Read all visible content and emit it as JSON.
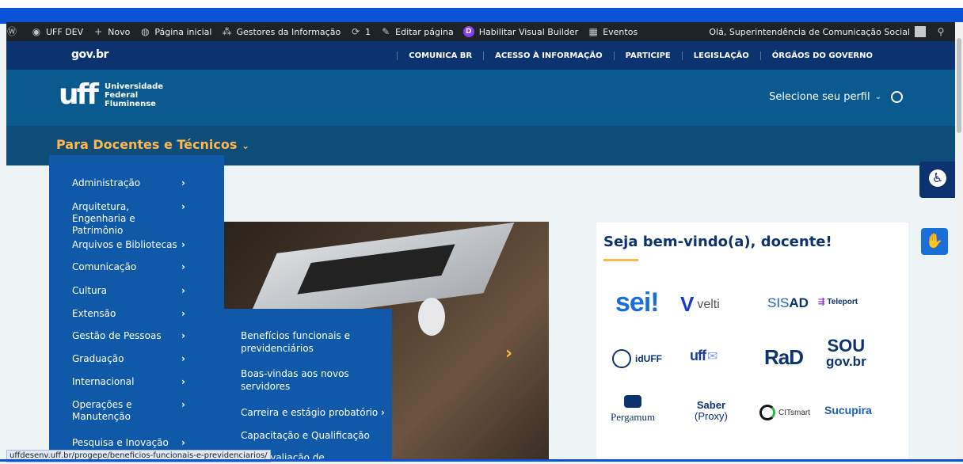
{
  "wpbar": {
    "site": "UFF DEV",
    "new": "Novo",
    "home": "Página inicial",
    "gestores": "Gestores da Informação",
    "updates": "1",
    "edit": "Editar página",
    "visual_builder": "Habilitar Visual Builder",
    "events": "Eventos",
    "greeting": "Olá, Superintendência de Comunicação Social"
  },
  "gov": {
    "logo": "gov.br",
    "links": [
      "COMUNICA BR",
      "ACESSO À INFORMAÇÃO",
      "PARTICIPE",
      "LEGISLAÇÃO",
      "ÓRGÃOS DO GOVERNO"
    ]
  },
  "header": {
    "mark": "uff",
    "name_line1": "Universidade",
    "name_line2": "Federal",
    "name_line3": "Fluminense",
    "profile": "Selecione seu perfil"
  },
  "subnav": {
    "title": "Para Docentes e Técnicos"
  },
  "menu": {
    "items": [
      "Administração",
      "Arquitetura, Engenharia e Patrimônio",
      "Arquivos e Bibliotecas",
      "Comunicação",
      "Cultura",
      "Extensão",
      "Gestão de Pessoas",
      "Graduação",
      "Internacional",
      "Operações e Manutenção",
      "Pesquisa e Inovação"
    ]
  },
  "submenu": {
    "items": [
      "Benefícios funcionais e previdenciários",
      "Boas-vindas aos novos servidores",
      "Carreira e estágio probatório",
      "Capacitação e Qualificação",
      "ão e Avaliação de"
    ]
  },
  "welcome": {
    "title": "Seja bem-vindo(a), docente!",
    "logos": {
      "sei": "sei!",
      "velti": "velti",
      "sisad_a": "SIS",
      "sisad_b": "AD",
      "teleport": "Teleport",
      "iduff": "idUFF",
      "uffmail": "uff",
      "rad": "RaD",
      "sou1": "SOU",
      "sou2": "gov.br",
      "pergamum": "Pergamum",
      "saber1": "Saber",
      "saber2": "(Proxy)",
      "citsmart": "CITsmart",
      "sucupira": "Sucupira"
    }
  },
  "status": {
    "url": "uffdesenv.uff.br/progepe/beneficios-funcionais-e-previdenciarios/"
  },
  "colors": {
    "gov_blue": "#0c326f",
    "header_blue": "#0b5a8f",
    "menu_blue": "#0f59a8",
    "accent": "#ffb84d"
  }
}
